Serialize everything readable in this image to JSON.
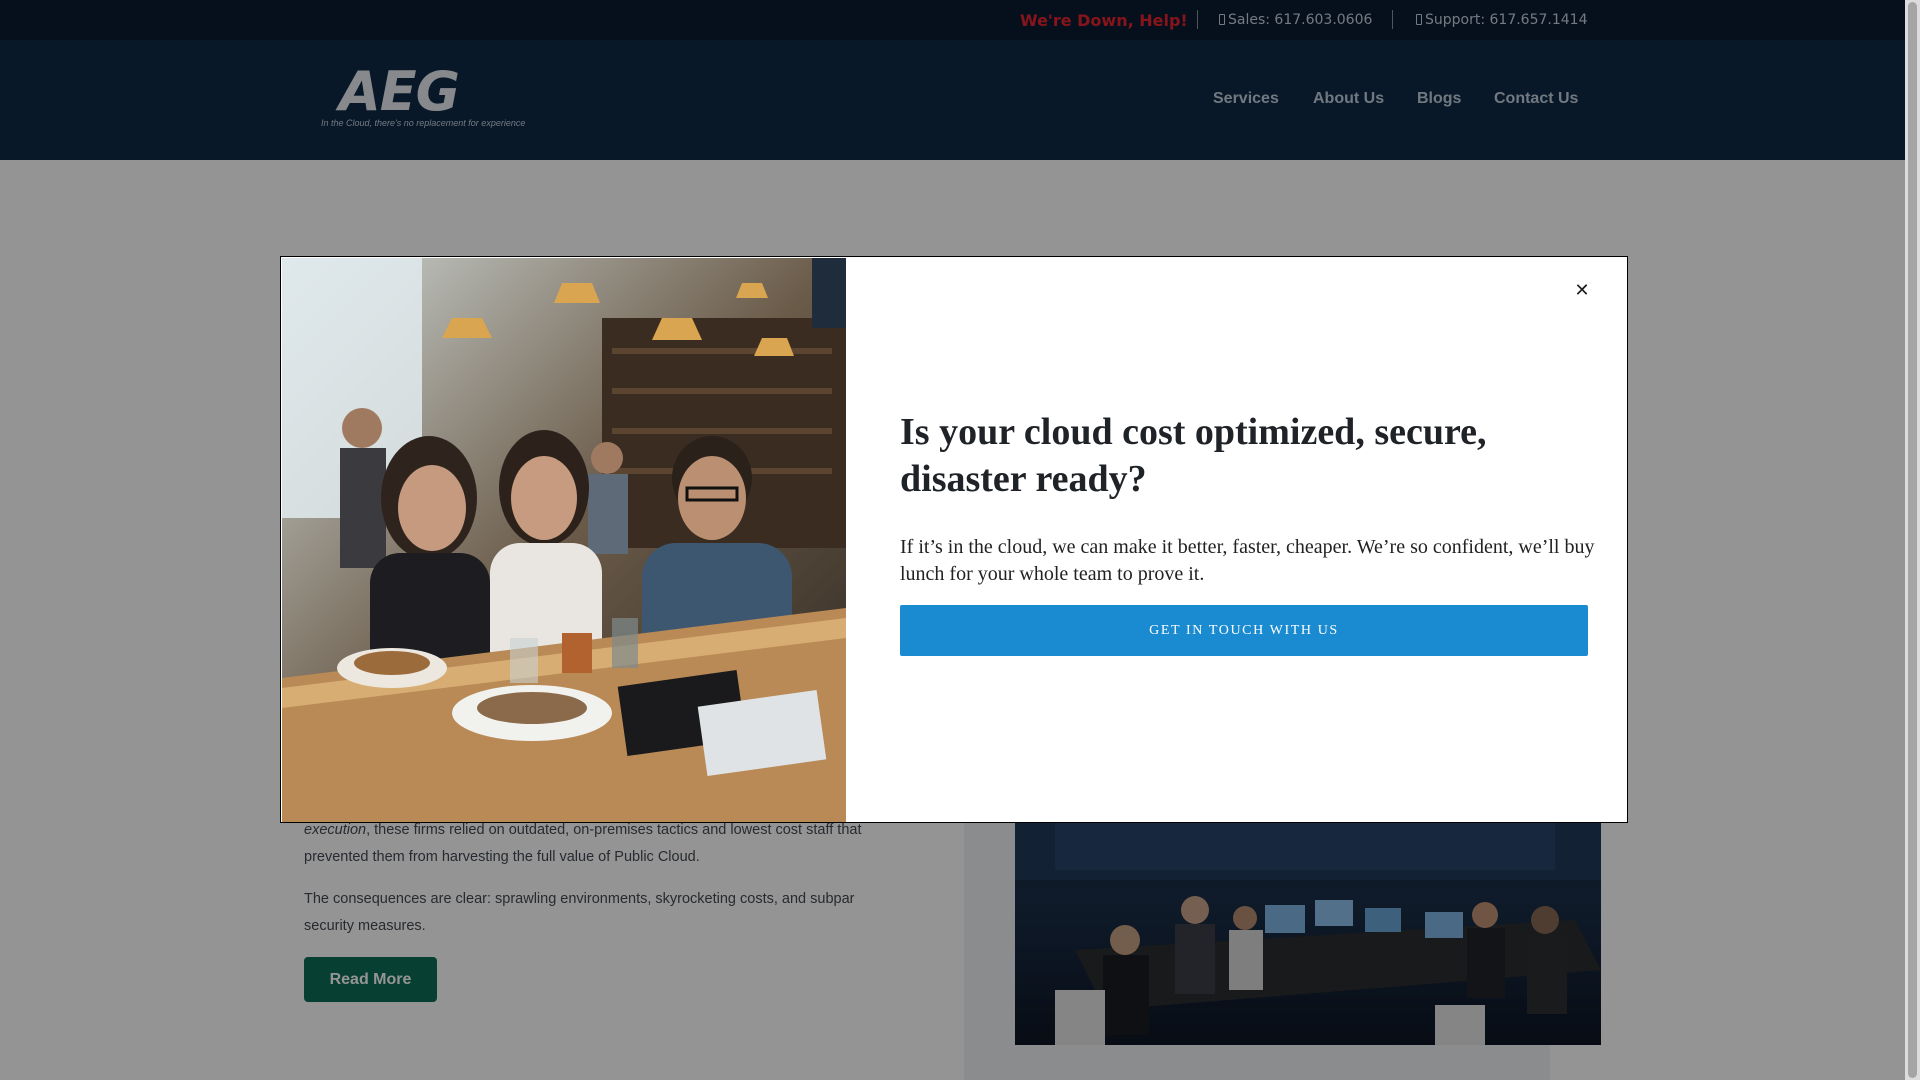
{
  "topbar": {
    "alert_label": "We're Down, Help!",
    "sales_label": "Sales: 617.603.0606",
    "support_label": "Support: 617.657.1414",
    "alert_color": "#e8232f"
  },
  "header": {
    "logo_text": "AEG",
    "logo_tagline": "In the Cloud, there's no replacement for experience",
    "nav": [
      "Services",
      "About Us",
      "Blogs",
      "Contact Us"
    ]
  },
  "content": {
    "para1_italic": "execution",
    "para1_rest": ", these firms relied on outdated, on-premises tactics and lowest cost staff that prevented them from harvesting the full value of Public Cloud.",
    "para2": "The consequences are clear: sprawling environments, skyrocketing costs, and subpar security measures.",
    "read_more_label": "Read More",
    "read_more_color": "#0d6e57"
  },
  "modal": {
    "title": "Is your cloud cost optimized, secure, disaster ready?",
    "body": "If it’s in the cloud, we can make it better, faster, cheaper. We’re so confident, we’ll buy lunch for your whole team to prove it.",
    "cta_label": "GET IN TOUCH WITH US",
    "cta_color": "#1b8bd1",
    "close_icon": "close-icon",
    "close_glyph": "✕"
  }
}
